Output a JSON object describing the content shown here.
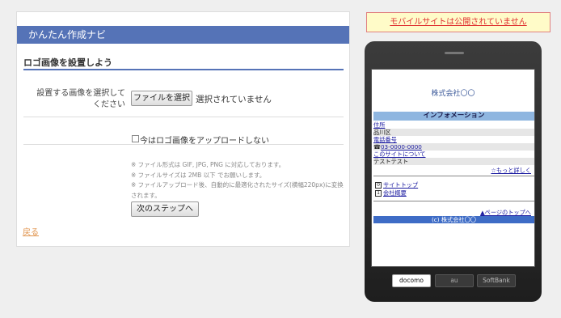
{
  "panel": {
    "header": "かんたん作成ナビ",
    "section_title": "ロゴ画像を設置しよう",
    "file_label": "設置する画像を選択してください",
    "file_button": "ファイルを選択",
    "file_status": "選択されていません",
    "checkbox_label": "今はロゴ画像をアップロードしない",
    "notes": [
      "※ ファイル形式は GIF, JPG, PNG に対応しております。",
      "※ ファイルサイズは 2MB 以下 でお願いします。",
      "※ ファイルアップロード後、自動的に最適化されたサイズ(横幅220px)に変換されます。"
    ],
    "next_button": "次のステップへ",
    "back_link": "戻る"
  },
  "notice": "モバイルサイトは公開されていません",
  "phone": {
    "company": "株式会社〇〇",
    "info_heading": "インフォメーション",
    "address_label": "住所",
    "address_value": "品川区",
    "phone_label": "電話番号",
    "phone_value": "03-0000-0000",
    "about_label": "このサイトについて",
    "test_text": "テストテスト",
    "more_link": "☆もっと詳しく",
    "nav": [
      {
        "num": "0",
        "label": "サイトトップ"
      },
      {
        "num": "1",
        "label": "会社概要"
      }
    ],
    "page_top": "▲ページのトップへ",
    "footer": "(c) 株式会社〇〇"
  },
  "carriers": [
    "docomo",
    "au",
    "SoftBank"
  ]
}
